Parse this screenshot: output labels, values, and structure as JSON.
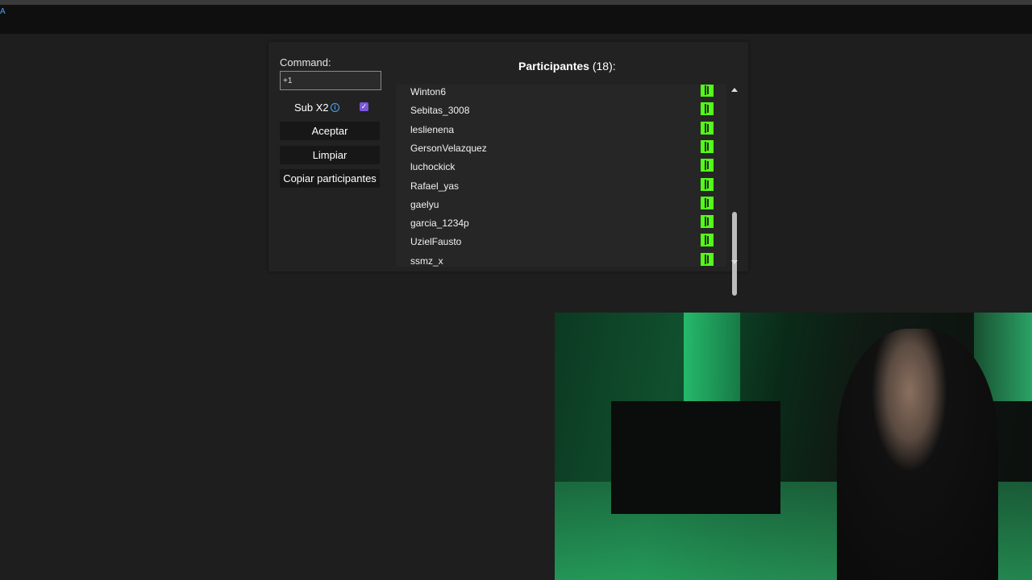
{
  "topbar": {
    "brand": "A"
  },
  "command": {
    "label": "Command:",
    "value": "+1"
  },
  "sub": {
    "label": "Sub X2",
    "info_glyph": "i",
    "checked_glyph": "✓"
  },
  "buttons": {
    "aceptar": "Aceptar",
    "limpiar": "Limpiar",
    "copiar": "Copiar participantes"
  },
  "participants": {
    "title": "Participantes",
    "count": "(18):",
    "items": [
      {
        "name": "Winton6",
        "icon": "kick-icon"
      },
      {
        "name": "Sebitas_3008",
        "icon": "kick-icon"
      },
      {
        "name": "leslienena",
        "icon": "kick-icon"
      },
      {
        "name": "GersonVelazquez",
        "icon": "kick-icon"
      },
      {
        "name": "luchockick",
        "icon": "kick-icon"
      },
      {
        "name": "Rafael_yas",
        "icon": "kick-icon"
      },
      {
        "name": "gaelyu",
        "icon": "kick-icon"
      },
      {
        "name": "garcia_1234p",
        "icon": "kick-icon"
      },
      {
        "name": "UzielFausto",
        "icon": "kick-icon"
      },
      {
        "name": "ssmz_x",
        "icon": "kick-icon"
      }
    ]
  },
  "colors": {
    "kick_green": "#53fc18",
    "checkbox_purple": "#7b56d8",
    "info_blue": "#4aa3ff"
  }
}
